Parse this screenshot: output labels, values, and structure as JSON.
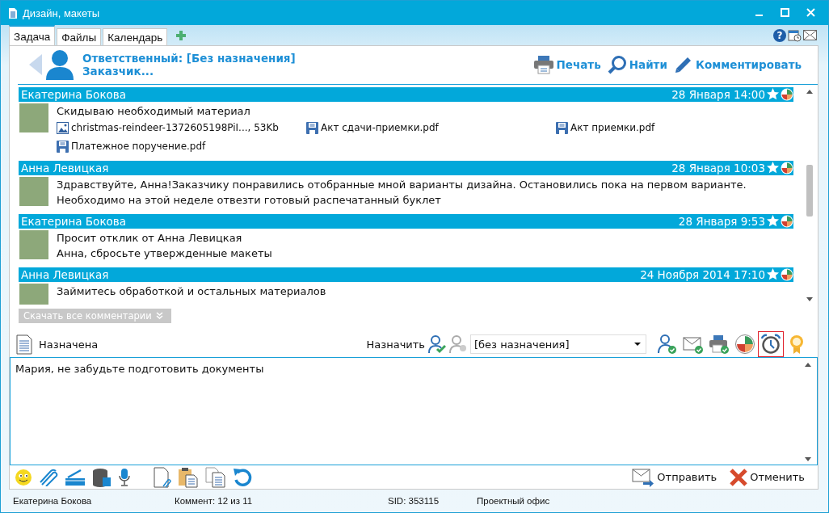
{
  "window": {
    "title": "Дизайн, макеты",
    "help": "?"
  },
  "tabs": [
    {
      "label": "Задача",
      "selected": true
    },
    {
      "label": "Файлы",
      "selected": false
    },
    {
      "label": "Календарь",
      "selected": false
    }
  ],
  "header": {
    "responsible": "Ответственный: [Без назначения]",
    "customer": "Заказчик...",
    "actions": [
      {
        "kind": "print",
        "label": "Печать"
      },
      {
        "kind": "find",
        "label": "Найти"
      },
      {
        "kind": "comment",
        "label": "Комментировать"
      }
    ]
  },
  "comments": [
    {
      "author": "Екатерина Бокова",
      "date": "28 Января 14:00",
      "lines": [
        "Скидываю необходимый материал"
      ],
      "attachments": [
        {
          "kind": "image",
          "name": "christmas-reindeer-1372605198PiI..., 53Kb"
        },
        {
          "kind": "file",
          "name": "Акт сдачи-приемки.pdf"
        },
        {
          "kind": "file",
          "name": "Акт приемки.pdf"
        },
        {
          "kind": "file",
          "name": "Платежное поручение.pdf"
        }
      ]
    },
    {
      "author": "Анна Левицкая",
      "date": "28 Января 10:03",
      "lines": [
        "Здравствуйте, Анна!Заказчику понравились отобранные мной варианты дизайна. Остановились пока на первом варианте.",
        "Необходимо на этой неделе отвезти готовый распечатанный буклет"
      ]
    },
    {
      "author": "Екатерина Бокова",
      "date": "28 Января 9:53",
      "lines": [
        "Просит отклик от Анна Левицкая",
        "Анна, сбросьте утвержденные макеты"
      ]
    },
    {
      "author": "Анна Левицкая",
      "date": "24 Ноября 2014 17:10",
      "lines": [
        "Займитесь обработкой и остальных материалов"
      ]
    }
  ],
  "download_all": "Скачать все комментарии",
  "assign": {
    "status": "Назначена",
    "label": "Назначить",
    "value": "[без назначения]",
    "tools": [
      {
        "kind": "user-check",
        "selected": false
      },
      {
        "kind": "mail-check",
        "selected": false
      },
      {
        "kind": "print-check",
        "selected": false
      },
      {
        "kind": "pie",
        "selected": false
      },
      {
        "kind": "alarm",
        "selected": true
      },
      {
        "kind": "award",
        "selected": false
      }
    ]
  },
  "editor": {
    "value": "Мария, не забудьте подготовить документы"
  },
  "send": "Отправить",
  "cancel": "Отменить",
  "status_bar": [
    "Екатерина Бокова",
    "Коммент: 12 из 11",
    "SID: 353115",
    "Проектный офис"
  ]
}
